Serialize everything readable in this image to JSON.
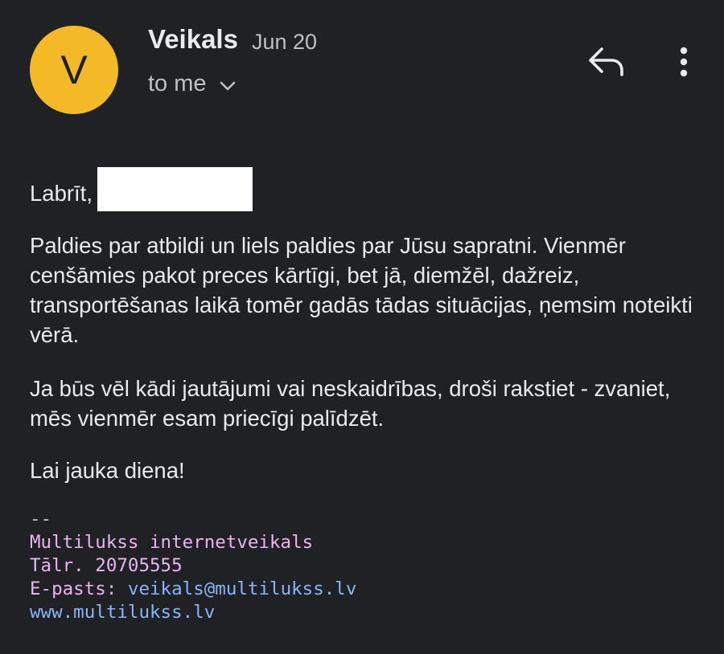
{
  "email": {
    "avatar_letter": "V",
    "avatar_color": "#f4b927",
    "sender": "Veikals",
    "date": "Jun 20",
    "recipient": "to me",
    "reply_icon": "reply-icon",
    "more_icon": "more-vert-icon"
  },
  "message": {
    "greeting": "Labrīt,",
    "paragraph1": "Paldies par atbildi un liels paldies par Jūsu sapratni. Vienmēr cenšāmies pakot preces kārtīgi, bet jā, diemžēl, dažreiz, transportēšanas laikā tomēr gadās tādas situācijas, ņemsim noteikti vērā.",
    "paragraph2": "Ja būs vēl kādi jautājumi vai neskaidrības, droši rakstiet - zvaniet, mēs vienmēr esam priecīgi palīdzēt.",
    "closing": "Lai jauka diena!"
  },
  "signature": {
    "separator": "--",
    "company": "Multilukss internetveikals",
    "phone": "Tālr. 20705555",
    "email_label": "E-pasts: ",
    "email": "veikals@multilukss.lv",
    "website": "www.multilukss.lv"
  }
}
